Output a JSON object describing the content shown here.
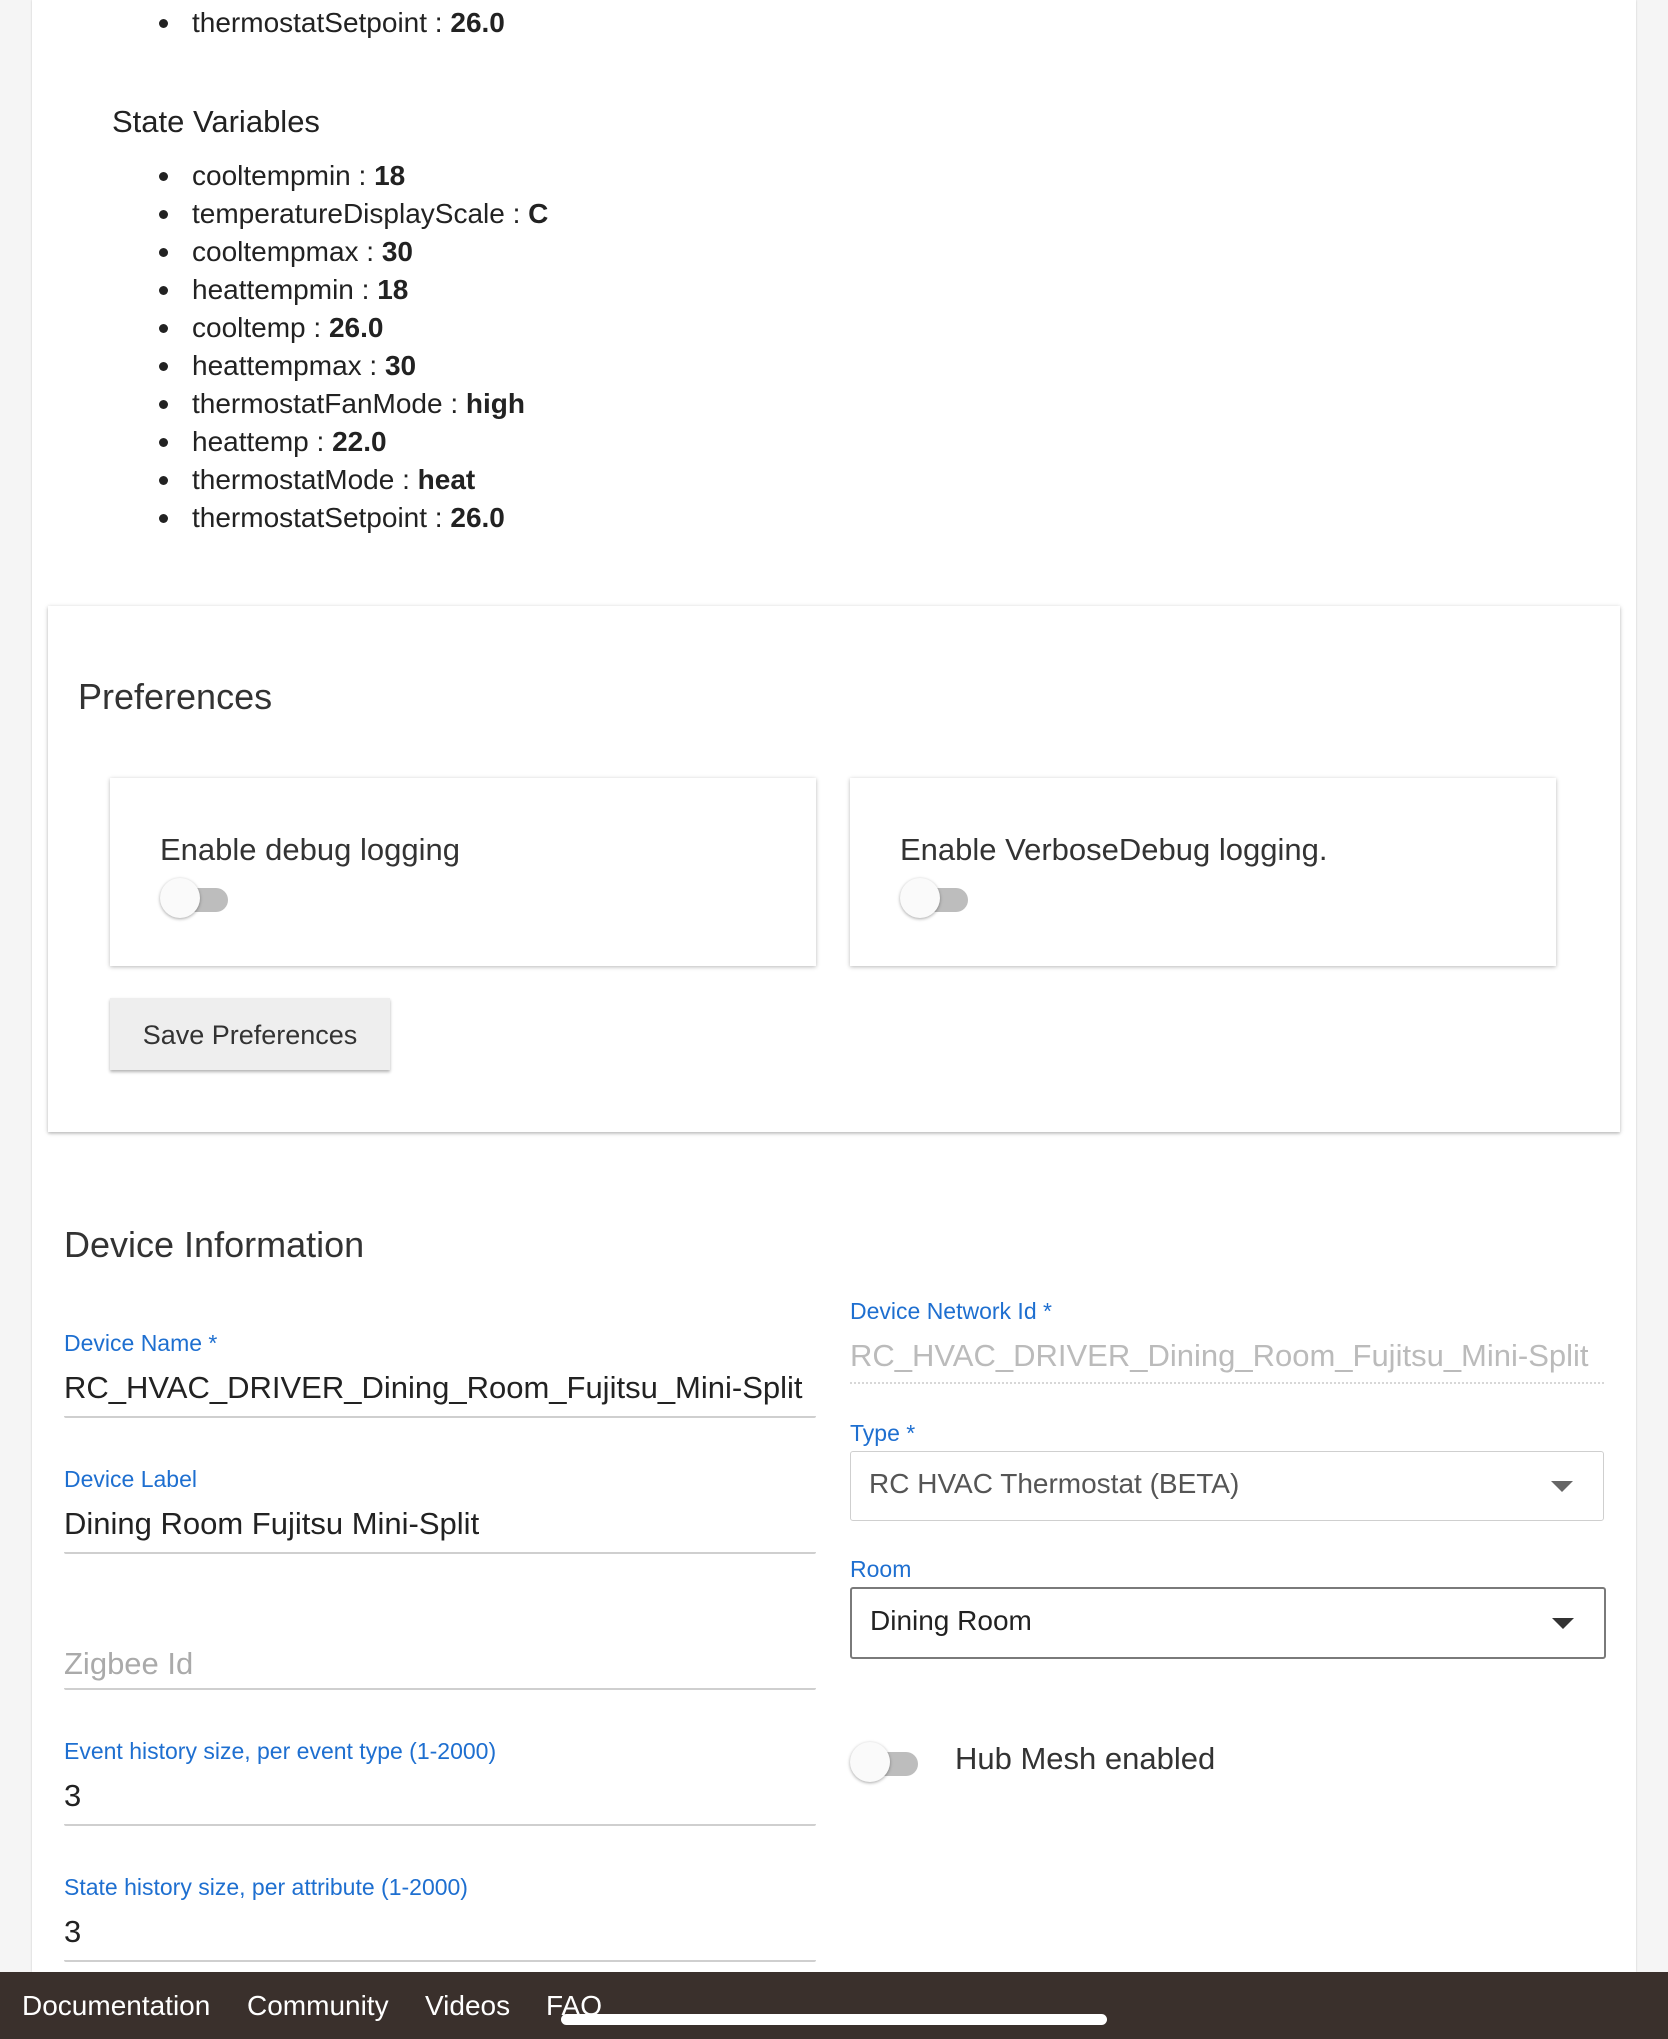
{
  "top_attributes": [
    {
      "key": "thermostatSetpoint",
      "value": "26.0"
    }
  ],
  "state_variables": {
    "title": "State Variables",
    "items": [
      {
        "key": "cooltempmin",
        "value": "18"
      },
      {
        "key": "temperatureDisplayScale",
        "value": "C"
      },
      {
        "key": "cooltempmax",
        "value": "30"
      },
      {
        "key": "heattempmin",
        "value": "18"
      },
      {
        "key": "cooltemp",
        "value": "26.0"
      },
      {
        "key": "heattempmax",
        "value": "30"
      },
      {
        "key": "thermostatFanMode",
        "value": "high"
      },
      {
        "key": "heattemp",
        "value": "22.0"
      },
      {
        "key": "thermostatMode",
        "value": "heat"
      },
      {
        "key": "thermostatSetpoint",
        "value": "26.0"
      }
    ]
  },
  "preferences": {
    "title": "Preferences",
    "debug_label": "Enable debug logging",
    "verbose_label": "Enable VerboseDebug logging.",
    "save_label": "Save Preferences"
  },
  "device_info": {
    "title": "Device Information",
    "device_name_label": "Device Name *",
    "device_name_value": "RC_HVAC_DRIVER_Dining_Room_Fujitsu_Mini-Split",
    "device_label_label": "Device Label",
    "device_label_value": "Dining Room Fujitsu Mini-Split",
    "zigbee_placeholder": "Zigbee Id",
    "event_history_label": "Event history size, per event type (1-2000)",
    "event_history_value": "3",
    "state_history_label": "State history size, per attribute (1-2000)",
    "state_history_value": "3",
    "network_id_label": "Device Network Id *",
    "network_id_value": "RC_HVAC_DRIVER_Dining_Room_Fujitsu_Mini-Split",
    "type_label": "Type *",
    "type_value": "RC HVAC Thermostat (BETA)",
    "room_label": "Room",
    "room_value": "Dining Room",
    "hub_mesh_label": "Hub Mesh enabled"
  },
  "footer": {
    "documentation": "Documentation",
    "community": "Community",
    "videos": "Videos",
    "faq": "FAQ"
  }
}
